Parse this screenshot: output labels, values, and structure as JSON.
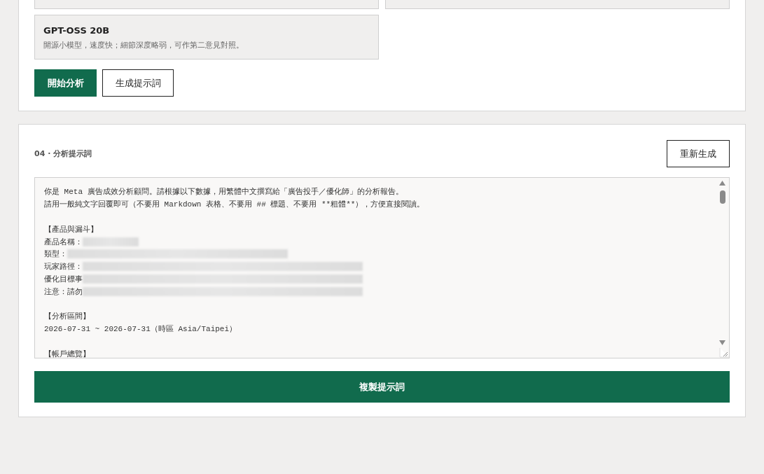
{
  "models": [
    {
      "name": "GPT-OSS 20B",
      "description": "開源小模型，速度快；細節深度略弱，可作第二意見對照。"
    }
  ],
  "actions": [
    {
      "label": "開始分析",
      "kind": "primary"
    },
    {
      "label": "生成提示詞",
      "kind": "outline"
    }
  ],
  "prompt_section": {
    "title": "04 · 分析提示詞",
    "regenerate_button": "重新生成",
    "lines": [
      {
        "text": "你是 Meta 廣告成效分析顧問。請根據以下數據，用繁體中文撰寫給「廣告投手／優化師」的分析報告。"
      },
      {
        "text": "請用一般純文字回覆即可（不要用 Markdown 表格、不要用 ## 標題、不要用 **粗體**），方便直接閱讀。"
      },
      {
        "kind": "blank"
      },
      {
        "text": "【產品與漏斗】"
      },
      {
        "text": "產品名稱：",
        "kind": "redacted"
      },
      {
        "text": "類型：",
        "kind": "redacted"
      },
      {
        "text": "玩家路徑：",
        "kind": "redacted"
      },
      {
        "text": "優化目標事",
        "kind": "redacted"
      },
      {
        "text": "注意：請勿",
        "kind": "redacted"
      },
      {
        "kind": "blank"
      },
      {
        "text": "【分析區間】"
      },
      {
        "text": "2026-07-31 ~ 2026-07-31（時區 Asia/Taipei）"
      },
      {
        "kind": "blank"
      },
      {
        "text": "【帳戶總覽】"
      }
    ],
    "copy_button": "複製提示詞"
  }
}
